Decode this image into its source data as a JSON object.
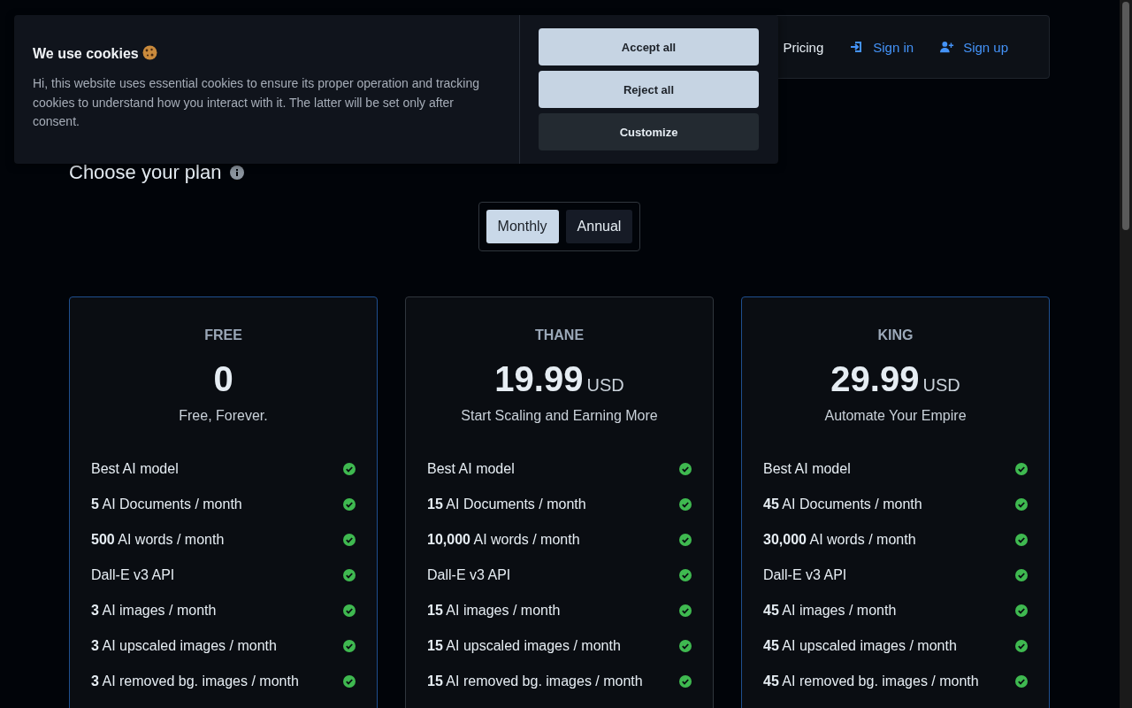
{
  "nav": {
    "items": [
      {
        "label": "Pricing",
        "kind": "text"
      },
      {
        "label": "Sign in",
        "kind": "signin"
      },
      {
        "label": "Sign up",
        "kind": "signup"
      }
    ]
  },
  "cookie_banner": {
    "title": "We use cookies",
    "text": "Hi, this website uses essential cookies to ensure its proper operation and tracking cookies to understand how you interact with it. The latter will be set only after consent.",
    "buttons": [
      {
        "label": "Accept all",
        "kind": "primary"
      },
      {
        "label": "Reject all",
        "kind": "primary"
      },
      {
        "label": "Customize",
        "kind": "secondary"
      }
    ]
  },
  "heading": "Choose your plan",
  "billing_toggle": [
    {
      "label": "Monthly",
      "selected": true
    },
    {
      "label": "Annual",
      "selected": false
    }
  ],
  "plans": [
    {
      "name": "FREE",
      "price": "0",
      "highlighted": true,
      "tagline": "Free, Forever.",
      "features": [
        "Best AI model",
        "**5** AI Documents / month",
        "**500** AI words / month",
        "Dall-E v3 API",
        "**3** AI images / month",
        "**3** AI upscaled images / month",
        "**3** AI removed bg. images / month"
      ]
    },
    {
      "name": "THANE",
      "price": "19.99",
      "currency": "USD",
      "highlighted": false,
      "tagline": "Start Scaling and Earning More",
      "features": [
        "Best AI model",
        "**15** AI Documents / month",
        "**10,000** AI words / month",
        "Dall-E v3 API",
        "**15** AI images / month",
        "**15** AI upscaled images / month",
        "**15** AI removed bg. images / month"
      ]
    },
    {
      "name": "KING",
      "price": "29.99",
      "currency": "USD",
      "highlighted": true,
      "tagline": "Automate Your Empire",
      "features": [
        "Best AI model",
        "**45** AI Documents / month",
        "**30,000** AI words / month",
        "Dall-E v3 API",
        "**45** AI images / month",
        "**45** AI upscaled images / month",
        "**45** AI removed bg. images / month"
      ]
    }
  ]
}
